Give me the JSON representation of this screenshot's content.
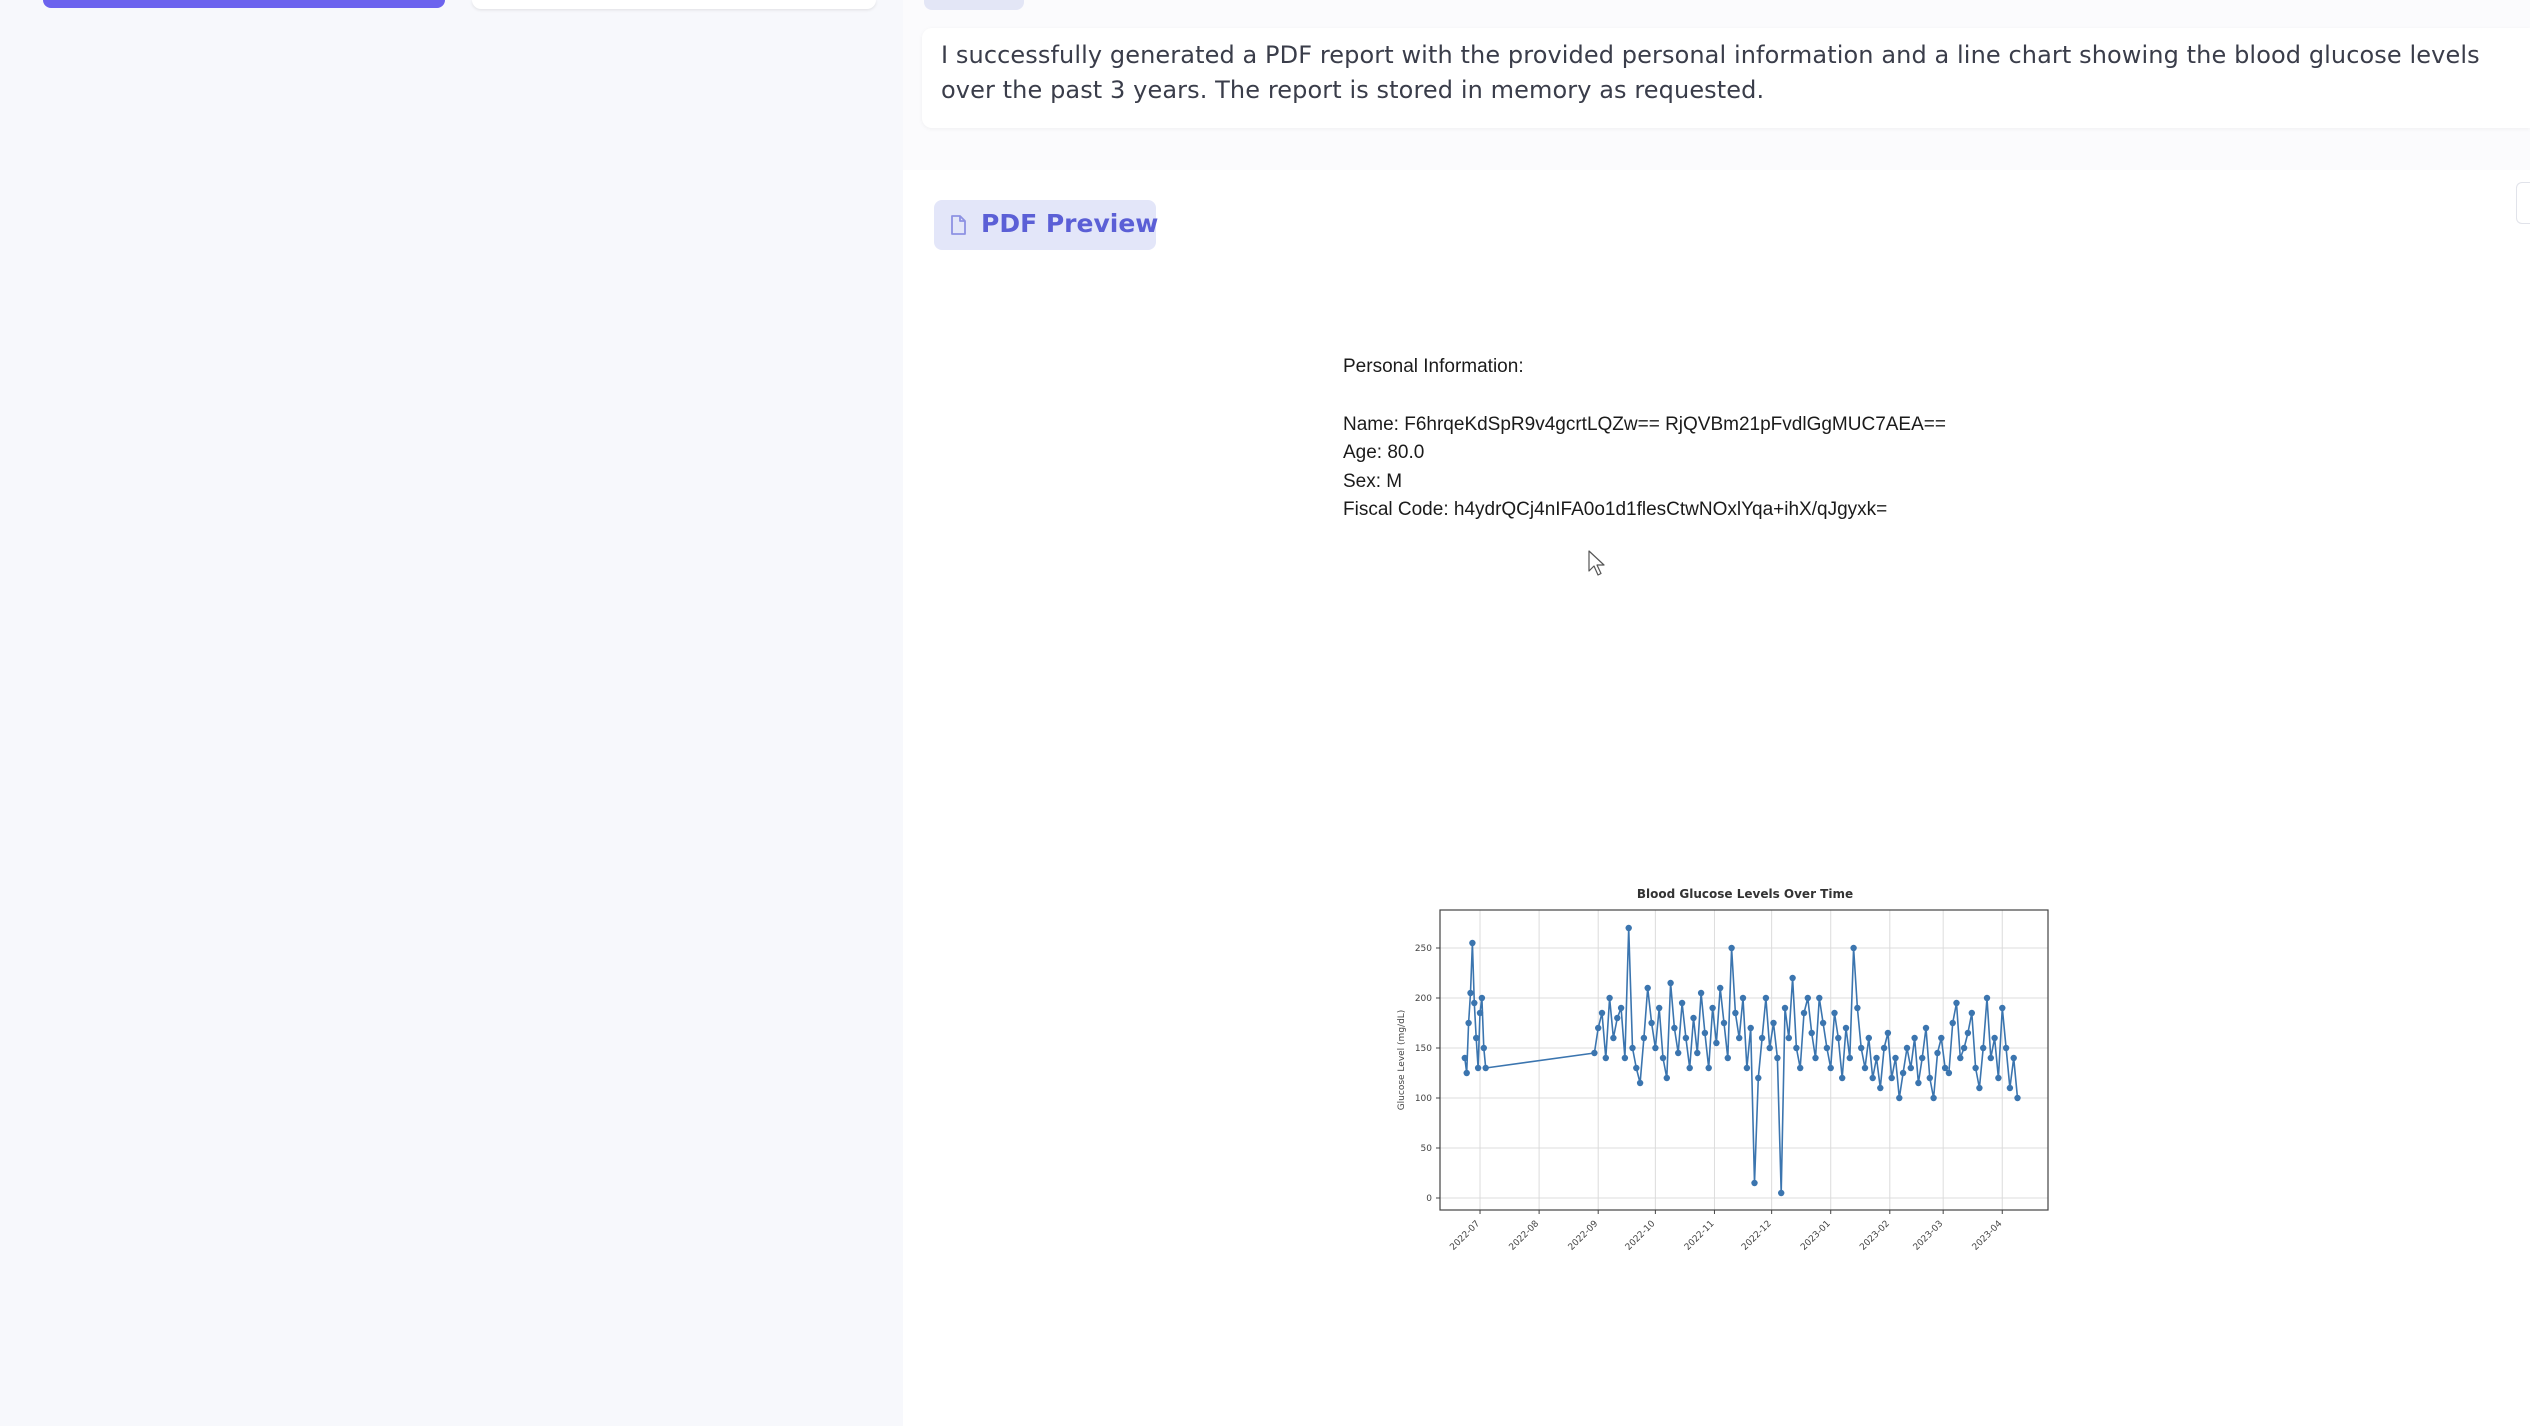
{
  "assistant_message": {
    "text": "I successfully generated a PDF report with the provided personal information and a line chart showing the blood glucose levels over the past 3 years. The report is stored in memory as requested."
  },
  "pdf_preview": {
    "badge_label": "PDF Preview",
    "badge_icon": "document-icon",
    "section_heading": "Personal Information:",
    "name_line": "Name: F6hrqeKdSpR9v4gcrtLQZw== RjQVBm21pFvdlGgMUC7AEA==",
    "age_line": "Age: 80.0",
    "sex_line": "Sex: M",
    "fiscal_code_line": "Fiscal Code: h4ydrQCj4nIFA0o1d1flesCtwNOxlYqa+ihX/qJgyxk="
  },
  "colors": {
    "accent": "#6c63ee",
    "badge_bg": "#e3e6f9",
    "badge_text": "#5b5fd6",
    "series": "#3b75af"
  },
  "chart_data": {
    "type": "line",
    "title": "Blood Glucose Levels Over Time",
    "xlabel": "",
    "ylabel": "Glucose Level (mg/dL)",
    "x_tick_labels": [
      "2022-07",
      "2022-08",
      "2022-09",
      "2022-10",
      "2022-11",
      "2022-12",
      "2023-01",
      "2023-02",
      "2023-03",
      "2023-04"
    ],
    "y_ticks": [
      0,
      50,
      100,
      150,
      200,
      250
    ],
    "xlim": [
      "2022-06-10",
      "2023-04-25"
    ],
    "ylim": [
      -12,
      288
    ],
    "grid": true,
    "marker": "circle",
    "series": [
      {
        "name": "",
        "x": [
          "2022-06-23",
          "2022-06-24",
          "2022-06-25",
          "2022-06-26",
          "2022-06-27",
          "2022-06-28",
          "2022-06-29",
          "2022-06-30",
          "2022-07-01",
          "2022-07-02",
          "2022-07-03",
          "2022-07-04",
          "2022-08-30",
          "2022-09-01",
          "2022-09-03",
          "2022-09-05",
          "2022-09-07",
          "2022-09-09",
          "2022-09-11",
          "2022-09-13",
          "2022-09-15",
          "2022-09-17",
          "2022-09-19",
          "2022-09-21",
          "2022-09-23",
          "2022-09-25",
          "2022-09-27",
          "2022-09-29",
          "2022-10-01",
          "2022-10-03",
          "2022-10-05",
          "2022-10-07",
          "2022-10-09",
          "2022-10-11",
          "2022-10-13",
          "2022-10-15",
          "2022-10-17",
          "2022-10-19",
          "2022-10-21",
          "2022-10-23",
          "2022-10-25",
          "2022-10-27",
          "2022-10-29",
          "2022-10-31",
          "2022-11-02",
          "2022-11-04",
          "2022-11-06",
          "2022-11-08",
          "2022-11-10",
          "2022-11-12",
          "2022-11-14",
          "2022-11-16",
          "2022-11-18",
          "2022-11-20",
          "2022-11-22",
          "2022-11-24",
          "2022-11-26",
          "2022-11-28",
          "2022-11-30",
          "2022-12-02",
          "2022-12-04",
          "2022-12-06",
          "2022-12-08",
          "2022-12-10",
          "2022-12-12",
          "2022-12-14",
          "2022-12-16",
          "2022-12-18",
          "2022-12-20",
          "2022-12-22",
          "2022-12-24",
          "2022-12-26",
          "2022-12-28",
          "2022-12-30",
          "2023-01-01",
          "2023-01-03",
          "2023-01-05",
          "2023-01-07",
          "2023-01-09",
          "2023-01-11",
          "2023-01-13",
          "2023-01-15",
          "2023-01-17",
          "2023-01-19",
          "2023-01-21",
          "2023-01-23",
          "2023-01-25",
          "2023-01-27",
          "2023-01-29",
          "2023-01-31",
          "2023-02-02",
          "2023-02-04",
          "2023-02-06",
          "2023-02-08",
          "2023-02-10",
          "2023-02-12",
          "2023-02-14",
          "2023-02-16",
          "2023-02-18",
          "2023-02-20",
          "2023-02-22",
          "2023-02-24",
          "2023-02-26",
          "2023-02-28",
          "2023-03-02",
          "2023-03-04",
          "2023-03-06",
          "2023-03-08",
          "2023-03-10",
          "2023-03-12",
          "2023-03-14",
          "2023-03-16",
          "2023-03-18",
          "2023-03-20",
          "2023-03-22",
          "2023-03-24",
          "2023-03-26",
          "2023-03-28",
          "2023-03-30",
          "2023-04-01",
          "2023-04-03",
          "2023-04-05",
          "2023-04-07",
          "2023-04-09"
        ],
        "y": [
          140,
          125,
          175,
          205,
          255,
          195,
          160,
          130,
          185,
          200,
          150,
          130,
          145,
          170,
          185,
          140,
          200,
          160,
          180,
          190,
          140,
          270,
          150,
          130,
          115,
          160,
          210,
          175,
          150,
          190,
          140,
          120,
          215,
          170,
          145,
          195,
          160,
          130,
          180,
          145,
          205,
          165,
          130,
          190,
          155,
          210,
          175,
          140,
          250,
          185,
          160,
          200,
          130,
          170,
          15,
          120,
          160,
          200,
          150,
          175,
          140,
          5,
          190,
          160,
          220,
          150,
          130,
          185,
          200,
          165,
          140,
          200,
          175,
          150,
          130,
          185,
          160,
          120,
          170,
          140,
          250,
          190,
          150,
          130,
          160,
          120,
          140,
          110,
          150,
          165,
          120,
          140,
          100,
          125,
          150,
          130,
          160,
          115,
          140,
          170,
          120,
          100,
          145,
          160,
          130,
          125,
          175,
          195,
          140,
          150,
          165,
          185,
          130,
          110,
          150,
          200,
          140,
          160,
          120,
          190,
          150,
          110,
          140,
          100
        ]
      }
    ]
  }
}
